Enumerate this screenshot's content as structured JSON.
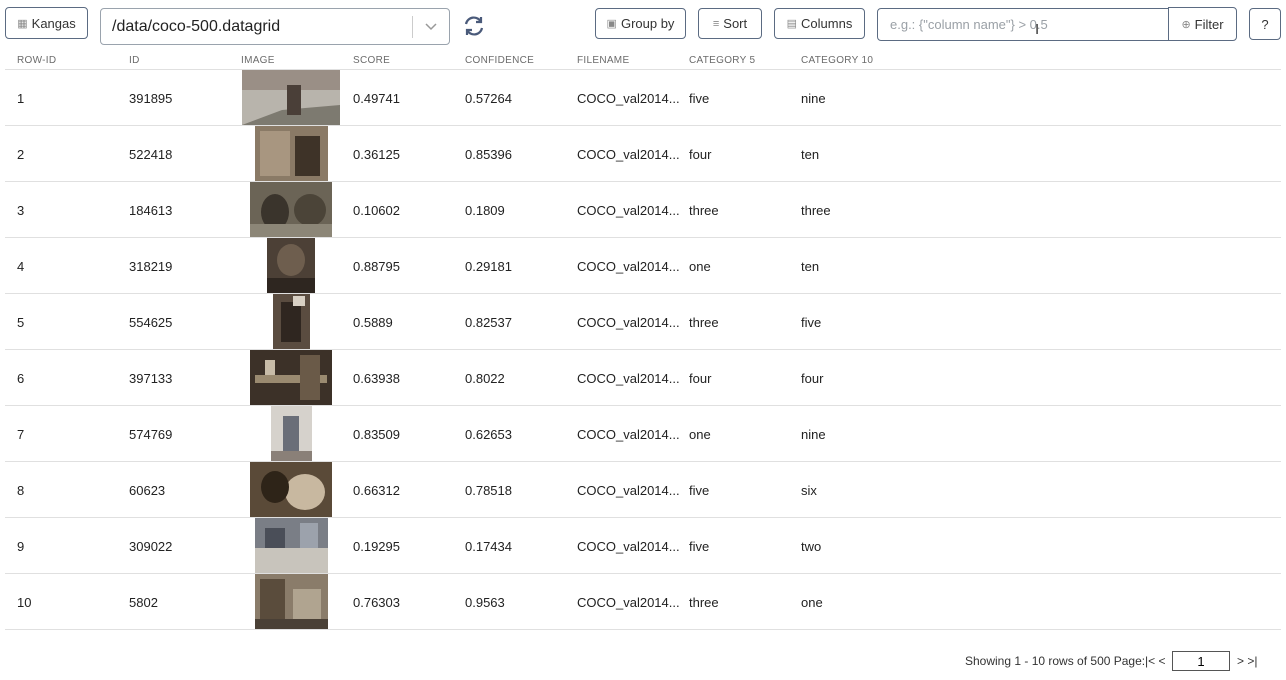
{
  "toolbar": {
    "kangas_label": "Kangas",
    "path_value": "/data/coco-500.datagrid",
    "group_by_label": "Group by",
    "sort_label": "Sort",
    "columns_label": "Columns",
    "filter_placeholder": "e.g.: {\"column name\"} > 0.5",
    "filter_label": "Filter",
    "help_label": "?"
  },
  "grid": {
    "headers": [
      "ROW-ID",
      "ID",
      "IMAGE",
      "SCORE",
      "CONFIDENCE",
      "FILENAME",
      "CATEGORY 5",
      "CATEGORY 10"
    ],
    "rows": [
      {
        "row_id": "1",
        "id": "391895",
        "score": "0.49741",
        "confidence": "0.57264",
        "filename": "COCO_val2014...",
        "category5": "five",
        "category10": "nine"
      },
      {
        "row_id": "2",
        "id": "522418",
        "score": "0.36125",
        "confidence": "0.85396",
        "filename": "COCO_val2014...",
        "category5": "four",
        "category10": "ten"
      },
      {
        "row_id": "3",
        "id": "184613",
        "score": "0.10602",
        "confidence": "0.1809",
        "filename": "COCO_val2014...",
        "category5": "three",
        "category10": "three"
      },
      {
        "row_id": "4",
        "id": "318219",
        "score": "0.88795",
        "confidence": "0.29181",
        "filename": "COCO_val2014...",
        "category5": "one",
        "category10": "ten"
      },
      {
        "row_id": "5",
        "id": "554625",
        "score": "0.5889",
        "confidence": "0.82537",
        "filename": "COCO_val2014...",
        "category5": "three",
        "category10": "five"
      },
      {
        "row_id": "6",
        "id": "397133",
        "score": "0.63938",
        "confidence": "0.8022",
        "filename": "COCO_val2014...",
        "category5": "four",
        "category10": "four"
      },
      {
        "row_id": "7",
        "id": "574769",
        "score": "0.83509",
        "confidence": "0.62653",
        "filename": "COCO_val2014...",
        "category5": "one",
        "category10": "nine"
      },
      {
        "row_id": "8",
        "id": "60623",
        "score": "0.66312",
        "confidence": "0.78518",
        "filename": "COCO_val2014...",
        "category5": "five",
        "category10": "six"
      },
      {
        "row_id": "9",
        "id": "309022",
        "score": "0.19295",
        "confidence": "0.17434",
        "filename": "COCO_val2014...",
        "category5": "five",
        "category10": "two"
      },
      {
        "row_id": "10",
        "id": "5802",
        "score": "0.76303",
        "confidence": "0.9563",
        "filename": "COCO_val2014...",
        "category5": "three",
        "category10": "one"
      }
    ]
  },
  "pager": {
    "summary": "Showing 1 - 10 rows of 500 Page:",
    "first_prev": "|< <",
    "page": "1",
    "next_last": "> >|"
  }
}
